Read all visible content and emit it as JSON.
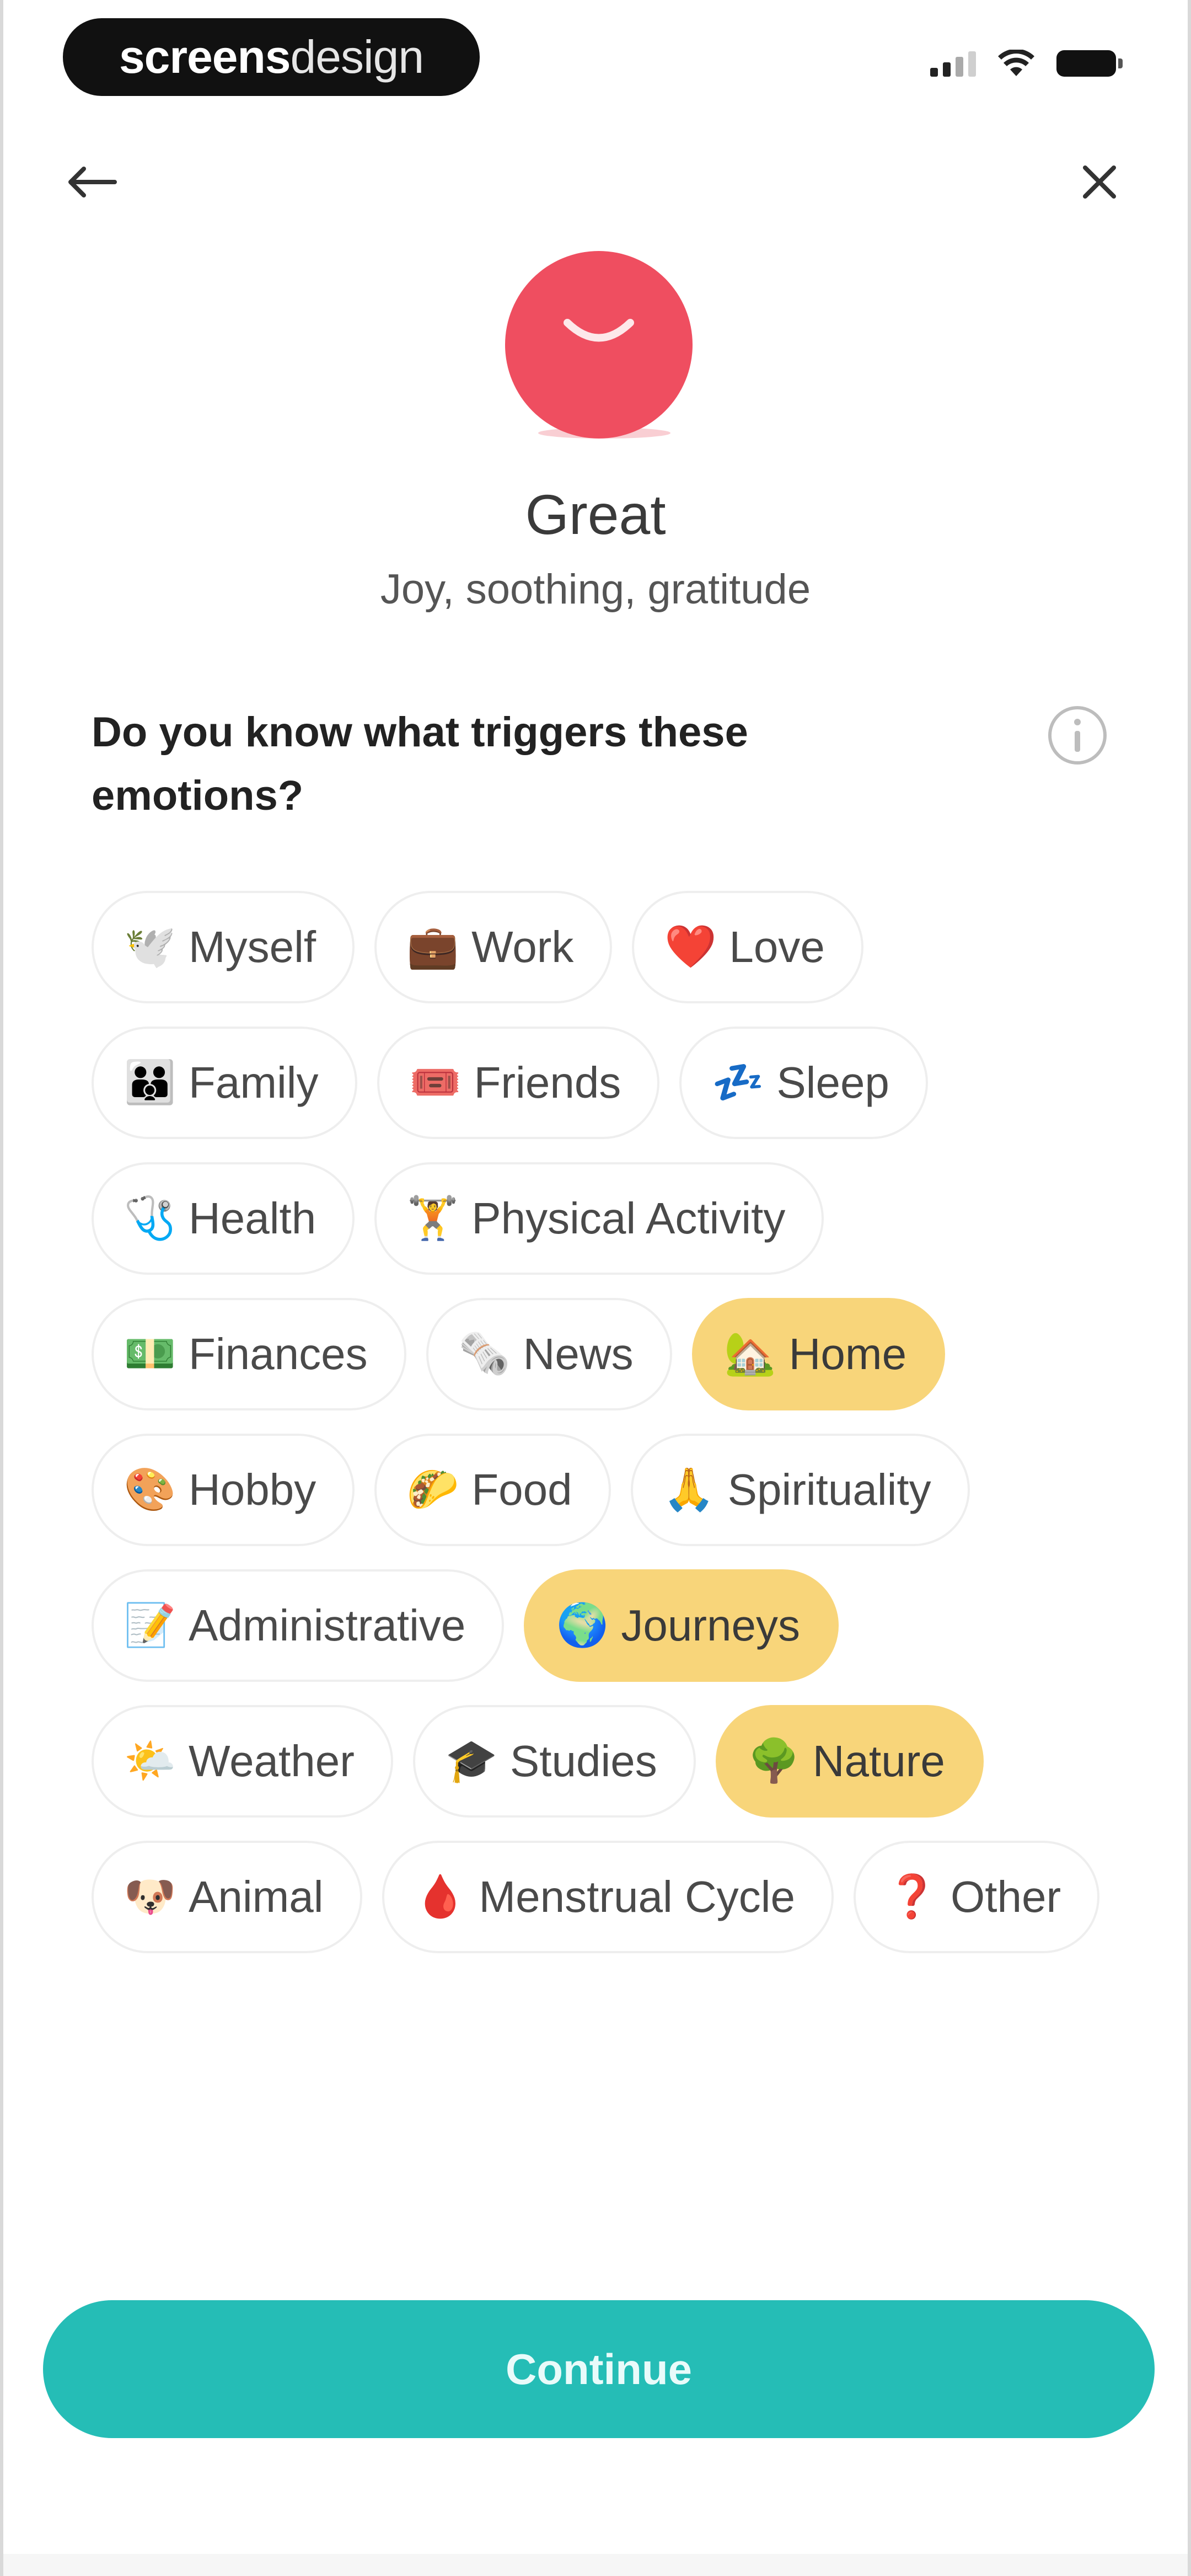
{
  "status_bar": {
    "watermark_bold": "screens",
    "watermark_light": "design"
  },
  "mood": {
    "title": "Great",
    "subtitle": "Joy, soothing, gratitude",
    "face_color": "#ef4e60"
  },
  "question": "Do you know what triggers these emotions?",
  "chips": [
    {
      "label": "Myself",
      "emoji": "🕊️",
      "selected": false
    },
    {
      "label": "Work",
      "emoji": "💼",
      "selected": false
    },
    {
      "label": "Love",
      "emoji": "❤️",
      "selected": false
    },
    {
      "label": "Family",
      "emoji": "👪",
      "selected": false
    },
    {
      "label": "Friends",
      "emoji": "🎟️",
      "selected": false
    },
    {
      "label": "Sleep",
      "emoji": "💤",
      "selected": false
    },
    {
      "label": "Health",
      "emoji": "🩺",
      "selected": false
    },
    {
      "label": "Physical Activity",
      "emoji": "🏋️",
      "selected": false
    },
    {
      "label": "Finances",
      "emoji": "💵",
      "selected": false
    },
    {
      "label": "News",
      "emoji": "🗞️",
      "selected": false
    },
    {
      "label": "Home",
      "emoji": "🏡",
      "selected": true
    },
    {
      "label": "Hobby",
      "emoji": "🎨",
      "selected": false
    },
    {
      "label": "Food",
      "emoji": "🌮",
      "selected": false
    },
    {
      "label": "Spirituality",
      "emoji": "🙏",
      "selected": false
    },
    {
      "label": "Administrative",
      "emoji": "📝",
      "selected": false
    },
    {
      "label": "Journeys",
      "emoji": "🌍",
      "selected": true
    },
    {
      "label": "Weather",
      "emoji": "🌤️",
      "selected": false
    },
    {
      "label": "Studies",
      "emoji": "🎓",
      "selected": false
    },
    {
      "label": "Nature",
      "emoji": "🌳",
      "selected": true
    },
    {
      "label": "Animal",
      "emoji": "🐶",
      "selected": false
    },
    {
      "label": "Menstrual Cycle",
      "emoji": "🩸",
      "selected": false
    },
    {
      "label": "Other",
      "emoji": "❓",
      "selected": false
    }
  ],
  "continue_label": "Continue",
  "colors": {
    "selected_chip": "#f8d57a",
    "continue_button": "#25bdb6"
  }
}
